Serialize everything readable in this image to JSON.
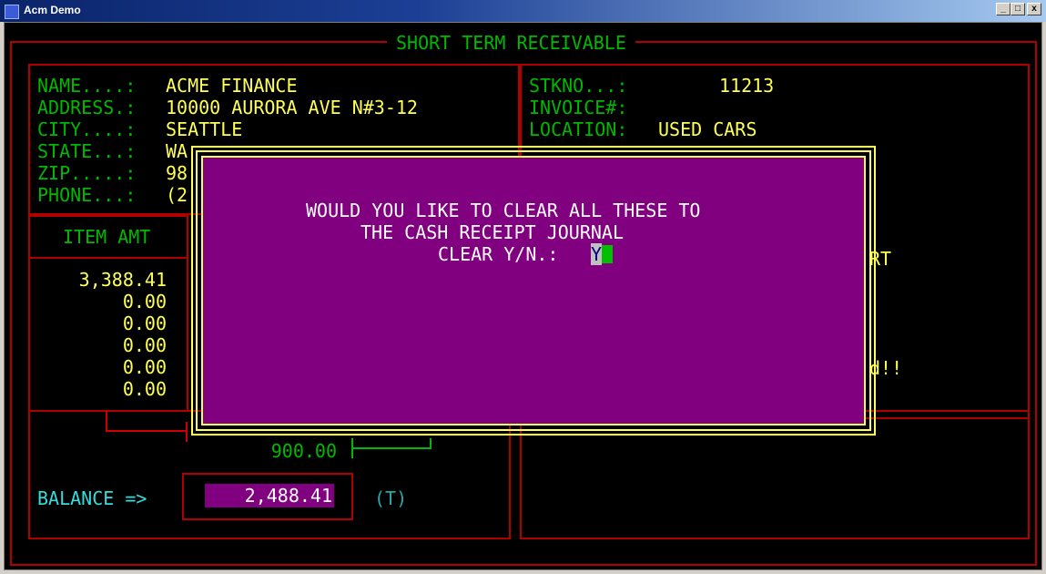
{
  "window": {
    "title": "Acm Demo",
    "minimize": "_",
    "maximize": "□",
    "close": "x"
  },
  "screen": {
    "header": "SHORT TERM RECEIVABLE"
  },
  "customer": {
    "name_label": "NAME....:",
    "name_value": "ACME FINANCE",
    "address_label": "ADDRESS.:",
    "address_value": "10000 AURORA AVE N#3-12",
    "city_label": "CITY....:",
    "city_value": "SEATTLE",
    "state_label": "STATE...:",
    "state_value": "WA",
    "zip_label": "ZIP.....:",
    "zip_value": "98",
    "phone_label": "PHONE...:",
    "phone_value": "(2"
  },
  "stock": {
    "stkno_label": "STKNO...:",
    "stkno_value": "11213",
    "invoice_label": "INVOICE#:",
    "location_label": "LOCATION:",
    "location_value": "USED CARS"
  },
  "items": {
    "header": "ITEM AMT",
    "amounts": [
      "3,388.41",
      "0.00",
      "0.00",
      "0.00",
      "0.00",
      "0.00"
    ]
  },
  "right_fragments": {
    "line1": "RT",
    "line2": "d!!"
  },
  "totals": {
    "paid": "900.00",
    "balance_label": "BALANCE =>",
    "balance_value": "2,488.41",
    "balance_flag": "(T)"
  },
  "dialog": {
    "line1": "WOULD YOU LIKE TO CLEAR ALL THESE TO",
    "line2": "THE CASH RECEIPT JOURNAL",
    "prompt": "CLEAR Y/N.:",
    "input_value": "Y"
  }
}
